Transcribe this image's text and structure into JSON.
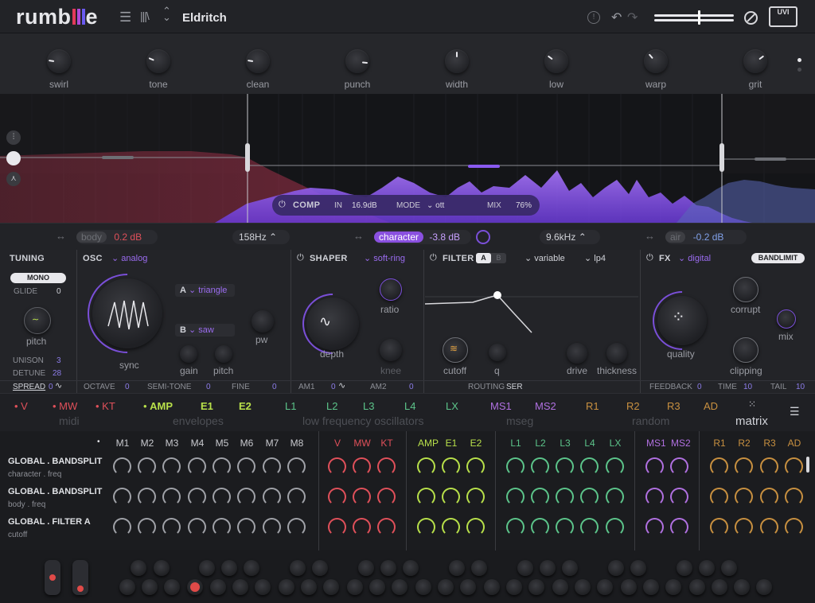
{
  "app": {
    "logo": "rumblle",
    "preset": "Eldritch"
  },
  "topbar": {
    "menu_icon": "hamburger-icon",
    "browse_icon": "library-icon",
    "arrows_icon": "up-down-arrows-icon"
  },
  "macros": [
    {
      "label": "swirl",
      "value": 0.2
    },
    {
      "label": "tone",
      "value": 0.25
    },
    {
      "label": "clean",
      "value": 0.2
    },
    {
      "label": "punch",
      "value": 0.85
    },
    {
      "label": "width",
      "value": 0.5
    },
    {
      "label": "low",
      "value": 0.3
    },
    {
      "label": "warp",
      "value": 0.35
    },
    {
      "label": "grit",
      "value": 0.7
    }
  ],
  "spectrum": {
    "comp_label": "COMP",
    "in_label": "IN",
    "in_value": "16.9dB",
    "mode_label": "MODE",
    "mode_value": "ott",
    "mix_label": "MIX",
    "mix_value": "76%"
  },
  "bands": {
    "body": "body",
    "body_value": "0.2 dB",
    "low_freq": "158Hz",
    "character": "character",
    "character_value": "-3.8 dB",
    "high_freq": "9.6kHz",
    "air": "air",
    "air_value": "-0.2 dB"
  },
  "tuning": {
    "title": "TUNING",
    "mono": "MONO",
    "glide_label": "GLIDE",
    "glide_value": "0",
    "pitch_label": "pitch",
    "unison_label": "UNISON",
    "unison_value": "3",
    "detune_label": "DETUNE",
    "detune_value": "28",
    "spread_label": "SPREAD",
    "spread_value": "0"
  },
  "osc": {
    "title": "OSC",
    "type": "analog",
    "a_label": "A",
    "a_wave": "triangle",
    "b_label": "B",
    "b_wave": "saw",
    "sync_label": "sync",
    "gain_label": "gain",
    "pitch_label": "pitch",
    "pw_label": "pw",
    "octave_label": "OCTAVE",
    "octave_value": "0",
    "semitone_label": "SEMI-TONE",
    "semitone_value": "0",
    "fine_label": "FINE",
    "fine_value": "0"
  },
  "shaper": {
    "title": "SHAPER",
    "type": "soft-ring",
    "depth_label": "depth",
    "ratio_label": "ratio",
    "knee_label": "knee",
    "am1_label": "AM1",
    "am1_value": "0",
    "am2_label": "AM2",
    "am2_value": "0"
  },
  "filter": {
    "title": "FILTER",
    "tab_a": "A",
    "tab_b": "B",
    "type": "variable",
    "slope": "lp4",
    "cutoff_label": "cutoff",
    "q_label": "q",
    "drive_label": "drive",
    "thickness_label": "thickness",
    "routing_label": "ROUTING",
    "routing_value": "SER"
  },
  "fx": {
    "title": "FX",
    "type": "digital",
    "bandlimit": "BANDLIMIT",
    "quality_label": "quality",
    "corrupt_label": "corrupt",
    "clipping_label": "clipping",
    "mix_label": "mix",
    "feedback_label": "FEEDBACK",
    "feedback_value": "0",
    "time_label": "TIME",
    "time_value": "10",
    "tail_label": "TAIL",
    "tail_value": "10"
  },
  "modsources": {
    "items": [
      {
        "label": "V",
        "color": "#e0505a",
        "dot": true
      },
      {
        "label": "MW",
        "color": "#e0505a",
        "dot": true
      },
      {
        "label": "KT",
        "color": "#e0505a",
        "dot": true
      },
      {
        "label": "AMP",
        "color": "#b8e04a",
        "dot": true
      },
      {
        "label": "E1",
        "color": "#b8e04a",
        "dot": false
      },
      {
        "label": "E2",
        "color": "#b8e04a",
        "dot": false
      },
      {
        "label": "L1",
        "color": "#5cc48a",
        "dot": false
      },
      {
        "label": "L2",
        "color": "#5cc48a",
        "dot": false
      },
      {
        "label": "L3",
        "color": "#5cc48a",
        "dot": false
      },
      {
        "label": "L4",
        "color": "#5cc48a",
        "dot": false
      },
      {
        "label": "LX",
        "color": "#5cc48a",
        "dot": false
      },
      {
        "label": "MS1",
        "color": "#b070e0",
        "dot": false
      },
      {
        "label": "MS2",
        "color": "#b070e0",
        "dot": false
      },
      {
        "label": "R1",
        "color": "#c89040",
        "dot": false
      },
      {
        "label": "R2",
        "color": "#c89040",
        "dot": false
      },
      {
        "label": "R3",
        "color": "#c89040",
        "dot": false
      },
      {
        "label": "AD",
        "color": "#c89040",
        "dot": false
      }
    ],
    "groups": [
      "midi",
      "envelopes",
      "low frequency oscillators",
      "mseg",
      "random"
    ],
    "matrix_label": "matrix"
  },
  "matrix": {
    "columns": [
      {
        "label": "M1",
        "color": "#c8c9ce"
      },
      {
        "label": "M2",
        "color": "#c8c9ce"
      },
      {
        "label": "M3",
        "color": "#c8c9ce"
      },
      {
        "label": "M4",
        "color": "#c8c9ce"
      },
      {
        "label": "M5",
        "color": "#c8c9ce"
      },
      {
        "label": "M6",
        "color": "#c8c9ce"
      },
      {
        "label": "M7",
        "color": "#c8c9ce"
      },
      {
        "label": "M8",
        "color": "#c8c9ce"
      },
      {
        "label": "V",
        "color": "#e0505a"
      },
      {
        "label": "MW",
        "color": "#e0505a"
      },
      {
        "label": "KT",
        "color": "#e0505a"
      },
      {
        "label": "AMP",
        "color": "#b8e04a"
      },
      {
        "label": "E1",
        "color": "#b8e04a"
      },
      {
        "label": "E2",
        "color": "#b8e04a"
      },
      {
        "label": "L1",
        "color": "#5cc48a"
      },
      {
        "label": "L2",
        "color": "#5cc48a"
      },
      {
        "label": "L3",
        "color": "#5cc48a"
      },
      {
        "label": "L4",
        "color": "#5cc48a"
      },
      {
        "label": "LX",
        "color": "#5cc48a"
      },
      {
        "label": "MS1",
        "color": "#b070e0"
      },
      {
        "label": "MS2",
        "color": "#b070e0"
      },
      {
        "label": "R1",
        "color": "#c89040"
      },
      {
        "label": "R2",
        "color": "#c89040"
      },
      {
        "label": "R3",
        "color": "#c89040"
      },
      {
        "label": "AD",
        "color": "#c89040"
      }
    ],
    "rows": [
      {
        "target": "GLOBAL . BANDSPLIT",
        "param": "character . freq"
      },
      {
        "target": "GLOBAL . BANDSPLIT",
        "param": "body . freq"
      },
      {
        "target": "GLOBAL . FILTER A",
        "param": "cutoff"
      }
    ]
  }
}
